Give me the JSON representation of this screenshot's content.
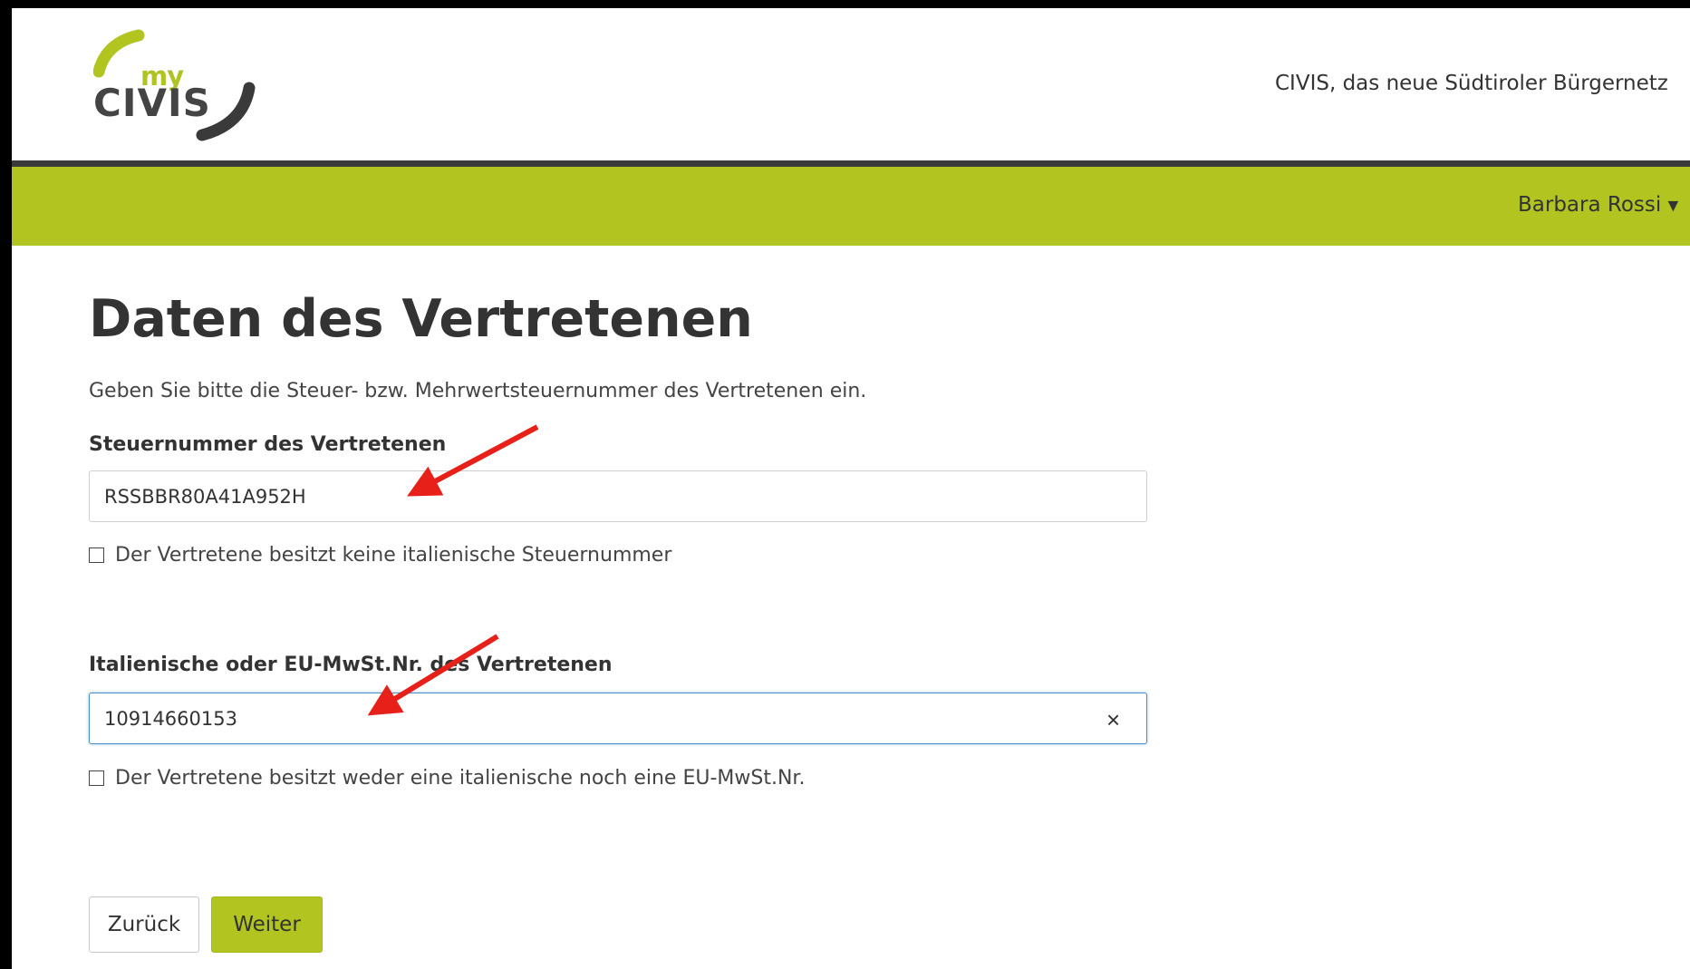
{
  "header": {
    "logo_my": "my",
    "logo_civis": "CIVIS",
    "tagline": "CIVIS, das neue Südtiroler Bürgernetz",
    "user_name": "Barbara Rossi"
  },
  "main": {
    "title": "Daten des Vertretenen",
    "intro": "Geben Sie bitte die Steuer- bzw. Mehrwertsteuernummer des Vertretenen ein.",
    "tax_label": "Steuernummer des Vertretenen",
    "tax_value": "RSSBBR80A41A952H",
    "tax_checkbox_label": "Der Vertretene besitzt keine italienische Steuernummer",
    "vat_label": "Italienische oder EU-MwSt.Nr. des Vertretenen",
    "vat_value": "10914660153",
    "vat_clear_symbol": "×",
    "vat_checkbox_label": "Der Vertretene besitzt weder eine italienische noch eine EU-MwSt.Nr.",
    "back_label": "Zurück",
    "next_label": "Weiter"
  },
  "colors": {
    "brand_green": "#b1c41f",
    "annotation_red": "#e8201a",
    "dark_rule": "#3a3a3a"
  },
  "icons": [
    "logo-arc-icon",
    "caret-down-icon",
    "clear-icon",
    "checkbox-icon",
    "annotation-arrow-icon"
  ]
}
